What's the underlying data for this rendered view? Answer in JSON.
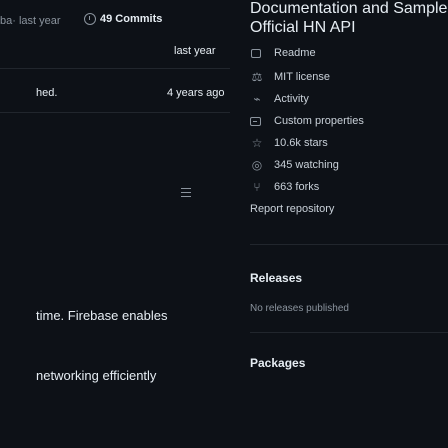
{
  "left": {
    "commit_message": "ba· last year",
    "commits_label": "49 Commits",
    "rows": [
      {
        "file": "",
        "time": "last year"
      },
      {
        "file": "hed.",
        "time": "4 years ago"
      }
    ],
    "readme_lines": [
      "time. Firebase enables",
      "networking efficiently"
    ]
  },
  "about": {
    "title_line1": "Documentation and Samples for",
    "title_line2": "Official HN API",
    "items": [
      {
        "icon": "book-icon",
        "label": "Readme"
      },
      {
        "icon": "law-icon",
        "label": "MIT license"
      },
      {
        "icon": "pulse-icon",
        "label": "Activity"
      },
      {
        "icon": "custom-properties-icon",
        "label": "Custom properties"
      },
      {
        "icon": "star-icon",
        "label": "10.6k stars"
      },
      {
        "icon": "eye-icon",
        "label": "345 watching"
      },
      {
        "icon": "fork-icon",
        "label": "663 forks"
      }
    ],
    "report_label": "Report repository"
  },
  "releases": {
    "heading": "Releases",
    "empty_text": "No releases published"
  },
  "packages": {
    "heading": "Packages"
  }
}
